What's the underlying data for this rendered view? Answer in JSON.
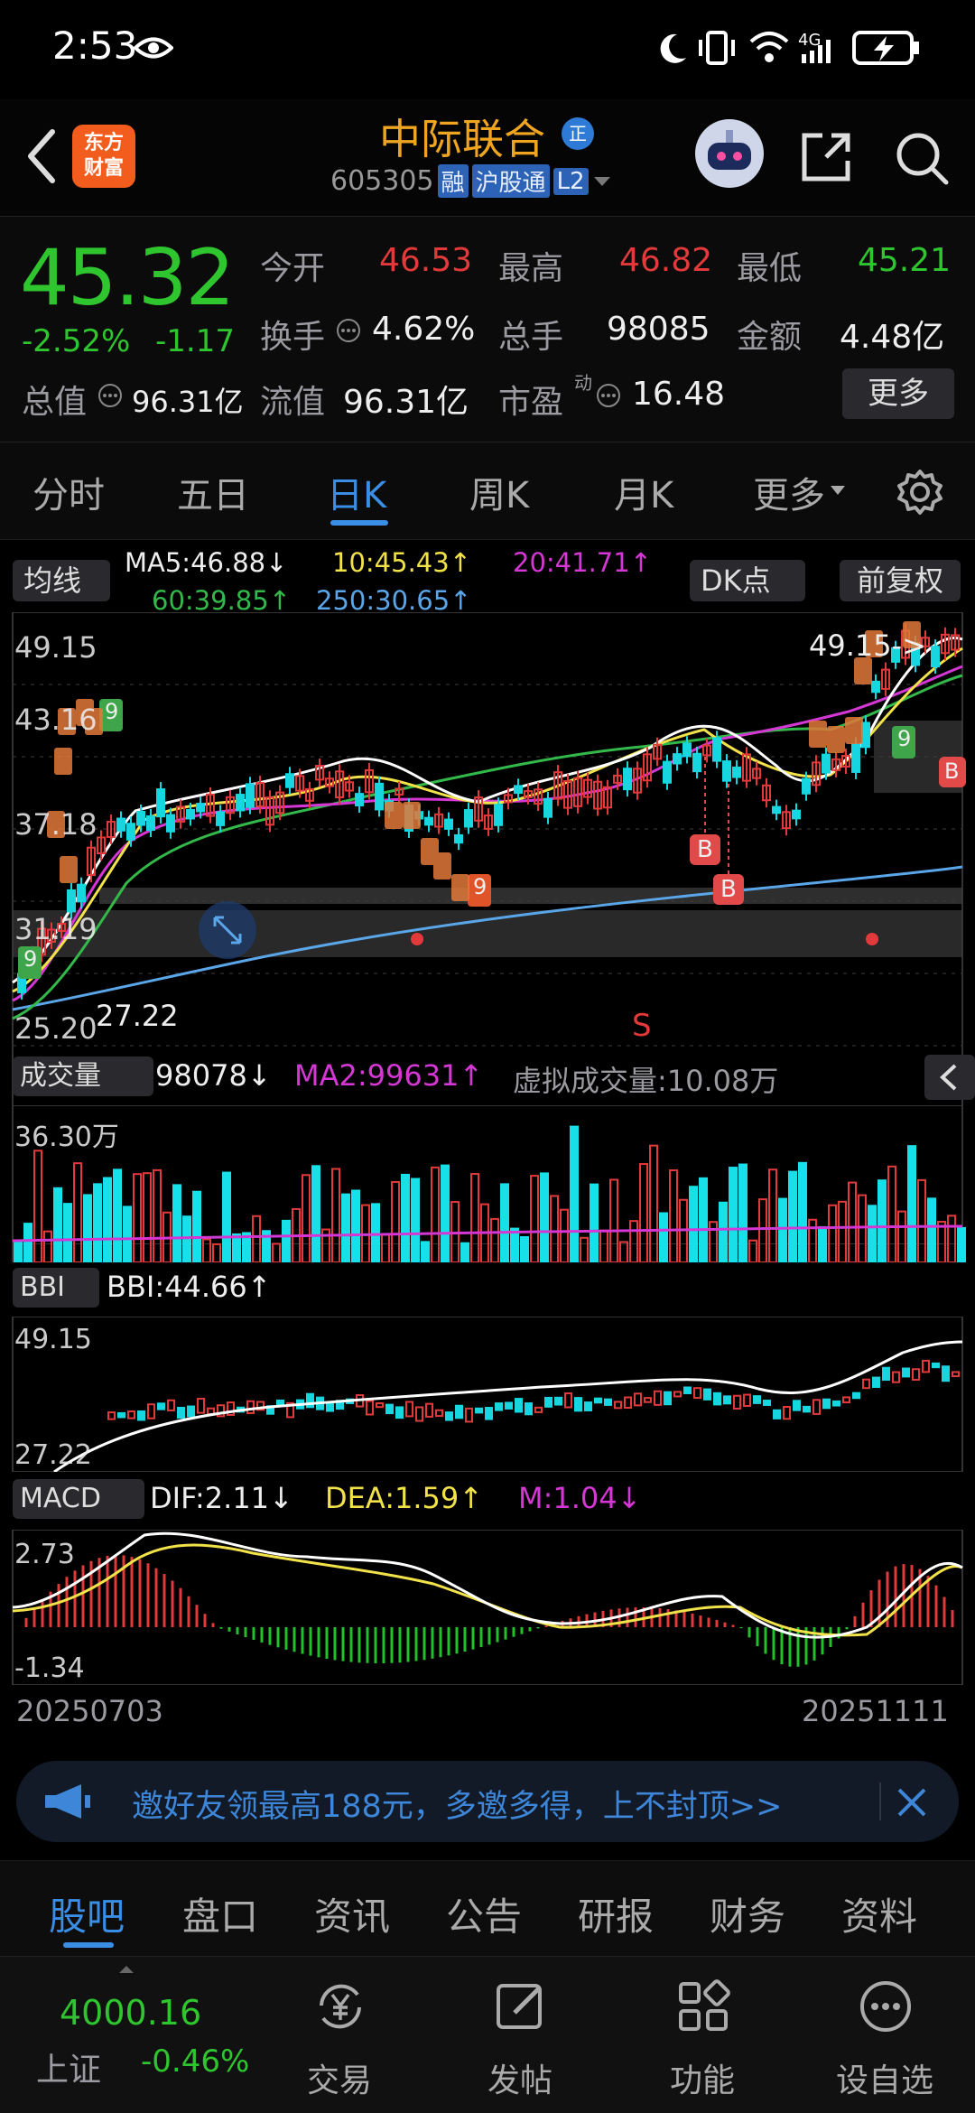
{
  "status_bar": {
    "time": "2:53"
  },
  "header": {
    "logo_text_1": "东方",
    "logo_text_2": "财富",
    "stock_name": "中际联合",
    "zheng_badge": "正",
    "code": "605305",
    "tags": [
      "融",
      "沪股通",
      "L2"
    ]
  },
  "quote": {
    "price": "45.32",
    "change_pct": "-2.52%",
    "change": "-1.17",
    "open_label": "今开",
    "open": "46.53",
    "high_label": "最高",
    "high": "46.82",
    "low_label": "最低",
    "low": "45.21",
    "turnover_label": "换手",
    "turnover": "4.62%",
    "volume_label": "总手",
    "volume": "98085",
    "amount_label": "金额",
    "amount": "4.48亿",
    "mktcap_label": "总值",
    "mktcap": "96.31亿",
    "float_label": "流值",
    "float": "96.31亿",
    "pe_label": "市盈",
    "pe_sup": "动",
    "pe": "16.48",
    "more": "更多"
  },
  "tabs": [
    "分时",
    "五日",
    "日K",
    "周K",
    "月K",
    "更多"
  ],
  "ma_bar": {
    "selector": "均线",
    "ma5": "MA5:46.88↓",
    "ma10": "10:45.43↑",
    "ma20": "20:41.71↑",
    "ma60": "60:39.85↑",
    "ma250": "250:30.65↑",
    "dk": "DK点",
    "fq": "前复权",
    "colors": {
      "ma5": "#ffffff",
      "ma10": "#f2e24a",
      "ma20": "#d437d4",
      "ma60": "#33b84a",
      "ma250": "#5aa6e8"
    }
  },
  "kline": {
    "y_labels": [
      "49.15",
      "43.16",
      "37.18",
      "31.19",
      "25.20"
    ],
    "max_marker": "49.15->",
    "min_marker": "27.22",
    "s_marker": "S",
    "b_marker": "B",
    "nine_marker": "9"
  },
  "volume_panel": {
    "selector": "成交量",
    "vol": "98078↓",
    "ma2": "MA2:99631↑",
    "virtual": "虚拟成交量:10.08万",
    "y_max": "36.30万"
  },
  "bbi_panel": {
    "selector": "BBI",
    "bbi": "BBI:44.66↑",
    "y_max": "49.15",
    "y_min": "27.22"
  },
  "macd_panel": {
    "selector": "MACD",
    "dif": "DIF:2.11↓",
    "dea": "DEA:1.59↑",
    "m": "M:1.04↓",
    "y_max": "2.73",
    "y_min": "-1.34"
  },
  "dates": {
    "start": "20250703",
    "end": "20251111"
  },
  "promo": {
    "text": "邀好友领最高188元，多邀多得，上不封顶>>"
  },
  "bottom_tabs": [
    "股吧",
    "盘口",
    "资讯",
    "公告",
    "研报",
    "财务",
    "资料"
  ],
  "bottom_nav": {
    "index_value": "4000.16",
    "index_name": "上证",
    "index_change": "-0.46%",
    "items": [
      "交易",
      "发帖",
      "功能",
      "设自选"
    ]
  }
}
